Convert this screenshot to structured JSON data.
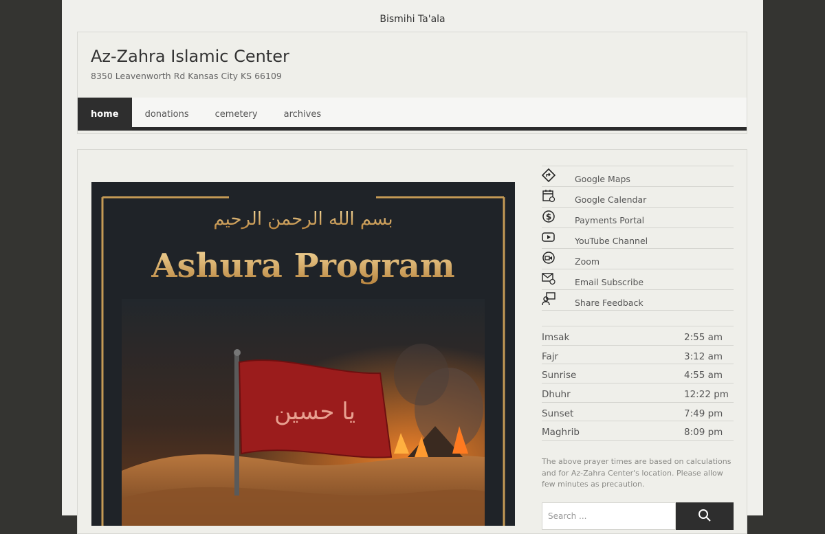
{
  "top": {
    "greeting": "Bismihi Ta'ala"
  },
  "header": {
    "title": "Az-Zahra Islamic Center",
    "address": "8350 Leavenworth Rd Kansas City KS 66109"
  },
  "nav": {
    "items": [
      {
        "label": "home",
        "active": true
      },
      {
        "label": "donations",
        "active": false
      },
      {
        "label": "cemetery",
        "active": false
      },
      {
        "label": "archives",
        "active": false
      }
    ]
  },
  "poster": {
    "title": "Ashura Program",
    "bismillah": "بسم الله الرحمن الرحيم",
    "flag_text": "يا حسين"
  },
  "links": [
    {
      "icon": "map-directions-icon",
      "label": "Google Maps"
    },
    {
      "icon": "calendar-icon",
      "label": "Google Calendar"
    },
    {
      "icon": "dollar-coin-icon",
      "label": "Payments Portal"
    },
    {
      "icon": "youtube-play-icon",
      "label": "YouTube Channel"
    },
    {
      "icon": "zoom-camera-icon",
      "label": "Zoom"
    },
    {
      "icon": "email-icon",
      "label": "Email Subscribe"
    },
    {
      "icon": "feedback-icon",
      "label": "Share Feedback"
    }
  ],
  "prayer_times": [
    {
      "name": "Imsak",
      "time": "2:55 am"
    },
    {
      "name": "Fajr",
      "time": "3:12 am"
    },
    {
      "name": "Sunrise",
      "time": "4:55 am"
    },
    {
      "name": "Dhuhr",
      "time": "12:22 pm"
    },
    {
      "name": "Sunset",
      "time": "7:49 pm"
    },
    {
      "name": "Maghrib",
      "time": "8:09 pm"
    }
  ],
  "prayer_note": "The above prayer times are based on calculations and for Az-Zahra Center's location. Please allow few minutes as precaution.",
  "search": {
    "placeholder": "Search ..."
  },
  "colors": {
    "background": "#343431",
    "page": "#f0f0ec",
    "nav_active": "#2e2e2e",
    "flag_red": "#9b1c1c"
  }
}
